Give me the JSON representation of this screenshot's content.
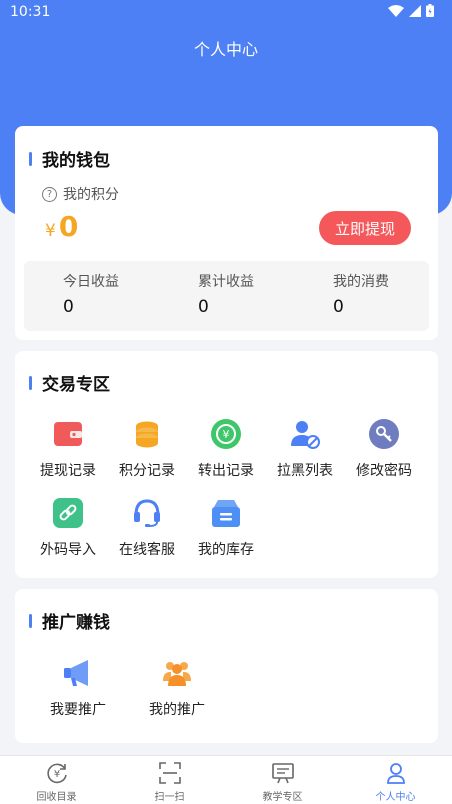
{
  "status_bar": {
    "time": "10:31"
  },
  "header": {
    "title": "个人中心"
  },
  "wallet": {
    "title": "我的钱包",
    "points_label": "我的积分",
    "currency": "¥",
    "balance": "0",
    "withdraw_button": "立即提现",
    "stats": [
      {
        "label": "今日收益",
        "value": "0"
      },
      {
        "label": "累计收益",
        "value": "0"
      },
      {
        "label": "我的消费",
        "value": "0"
      }
    ]
  },
  "trade": {
    "title": "交易专区",
    "items": [
      {
        "label": "提现记录",
        "icon": "wallet-icon",
        "color": "#f05a5a"
      },
      {
        "label": "积分记录",
        "icon": "coins-icon",
        "color": "#f5a623"
      },
      {
        "label": "转出记录",
        "icon": "transfer-icon",
        "color": "#3ec76a"
      },
      {
        "label": "拉黑列表",
        "icon": "block-user-icon",
        "color": "#4d7ff5"
      },
      {
        "label": "修改密码",
        "icon": "key-icon",
        "color": "#6f7cc0"
      },
      {
        "label": "外码导入",
        "icon": "link-icon",
        "color": "#3ec28a"
      },
      {
        "label": "在线客服",
        "icon": "headset-icon",
        "color": "#4d7ff5"
      },
      {
        "label": "我的库存",
        "icon": "inventory-box-icon",
        "color": "#4d8ff5"
      }
    ]
  },
  "promo": {
    "title": "推广赚钱",
    "items": [
      {
        "label": "我要推广",
        "icon": "megaphone-icon",
        "color": "#4d7ff5"
      },
      {
        "label": "我的推广",
        "icon": "team-icon",
        "color": "#f5902a"
      }
    ]
  },
  "tabbar": {
    "tabs": [
      {
        "label": "回收目录",
        "icon": "recycle-yen-icon"
      },
      {
        "label": "扫一扫",
        "icon": "scan-icon"
      },
      {
        "label": "教学专区",
        "icon": "teaching-board-icon"
      },
      {
        "label": "个人中心",
        "icon": "person-icon"
      }
    ],
    "active_index": 3,
    "active_color": "#4d7ff5"
  }
}
